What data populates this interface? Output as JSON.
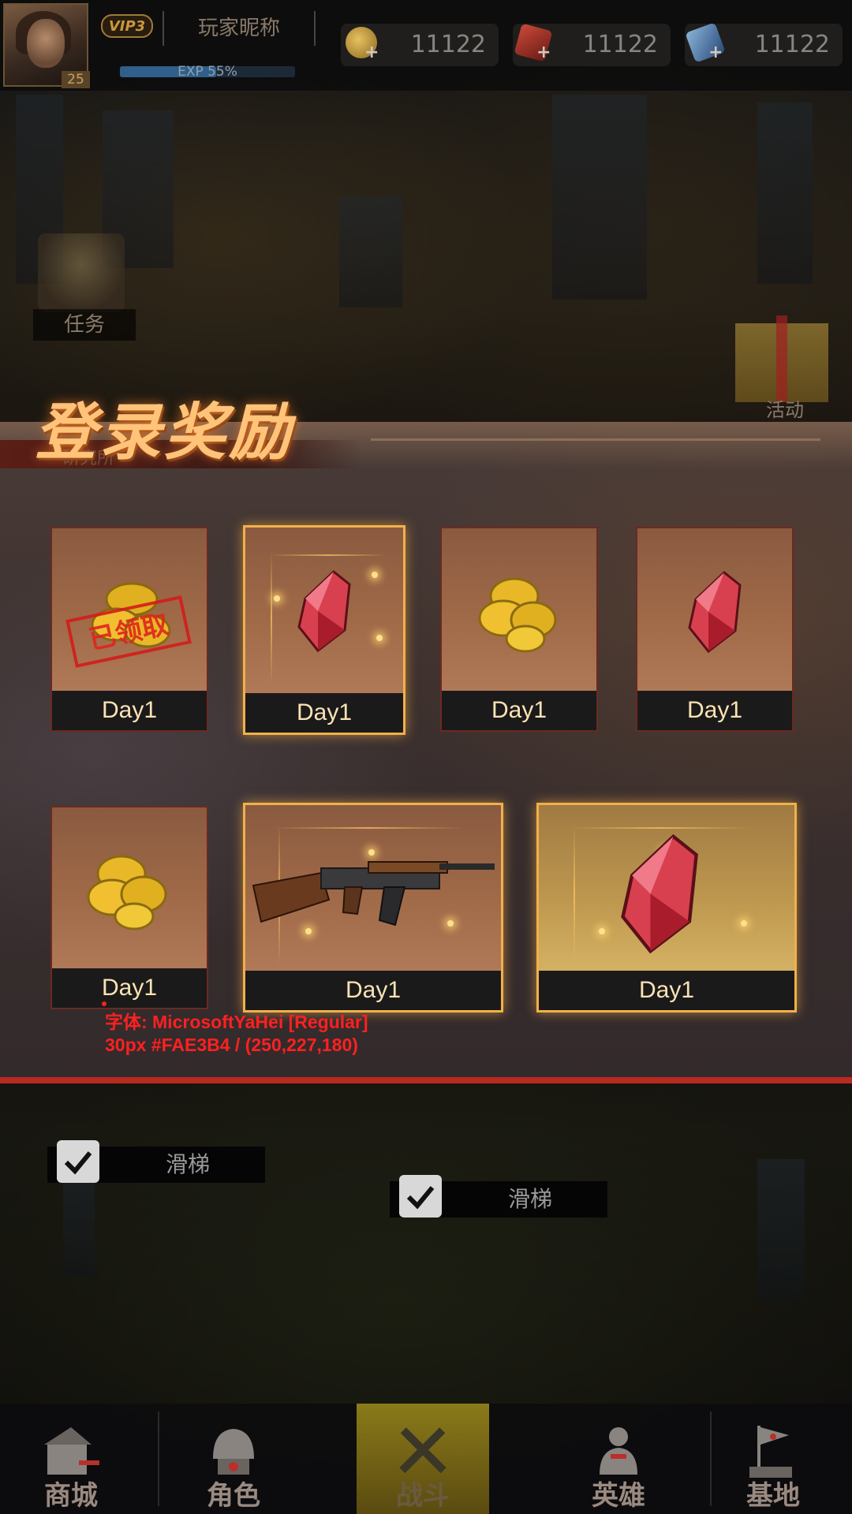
{
  "player": {
    "vip": "VIP3",
    "nickname": "玩家昵称",
    "level": "25",
    "exp_label": "EXP 55%",
    "exp_percent": 55
  },
  "currencies": [
    {
      "icon": "gold-coin-icon",
      "amount": "11122"
    },
    {
      "icon": "red-gem-icon",
      "amount": "11122"
    },
    {
      "icon": "blue-gem-icon",
      "amount": "11122"
    }
  ],
  "side": {
    "task_label": "任务",
    "event_label": "活动",
    "hidden_label": "研究所"
  },
  "panel": {
    "title": "登录奖励",
    "rewards_row1": [
      {
        "label": "Day1",
        "item": "gold-coins-icon",
        "claimed": true,
        "stamp": "已领取"
      },
      {
        "label": "Day1",
        "item": "red-crystal-icon",
        "highlight": true
      },
      {
        "label": "Day1",
        "item": "gold-coins-icon"
      },
      {
        "label": "Day1",
        "item": "red-crystal-icon"
      }
    ],
    "rewards_row2": [
      {
        "label": "Day1",
        "item": "gold-coins-icon"
      },
      {
        "label": "Day1",
        "item": "rifle-icon",
        "highlight": true
      },
      {
        "label": "Day1",
        "item": "red-crystal-icon",
        "highlight": true,
        "gold": true
      }
    ]
  },
  "annotation": {
    "line1": "字体: MicrosoftYaHei [Regular]",
    "line2": "30px #FAE3B4 / (250,227,180)"
  },
  "checkboxes": [
    {
      "label": "滑梯",
      "checked": true
    },
    {
      "label": "滑梯",
      "checked": true
    }
  ],
  "nav": [
    {
      "label": "商城",
      "icon": "shop-icon"
    },
    {
      "label": "角色",
      "icon": "helmet-icon"
    },
    {
      "label": "战斗",
      "icon": "crossed-guns-icon",
      "active": true
    },
    {
      "label": "英雄",
      "icon": "hero-icon"
    },
    {
      "label": "基地",
      "icon": "base-flag-icon"
    }
  ],
  "colors": {
    "label_text": "#FAE3B4",
    "highlight_border": "#F2B04A",
    "accent_red": "#B82A20"
  }
}
